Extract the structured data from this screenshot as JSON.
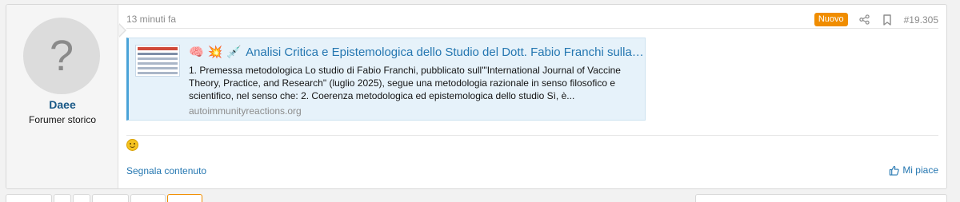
{
  "post": {
    "user": {
      "avatar_glyph": "?",
      "username": "Daee",
      "title": "Forumer storico"
    },
    "header": {
      "time": "13 minuti fa",
      "badge": "Nuovo",
      "post_number": "#19.305",
      "badge_color": "#f08d00"
    },
    "embed": {
      "emojis": [
        "🧠",
        "💥",
        "💉"
      ],
      "title": "Analisi Critica e Epistemologica dello Studio del Dott. Fabio Franchi sulla F...",
      "description": "1. Premessa metodologica Lo studio di Fabio Franchi, pubblicato sull'\"International Journal of Vaccine Theory, Practice, and Research\" (luglio 2025), segue una metodologia razionale in senso filosofico e scientifico, nel senso che: 2. Coerenza metodologica ed epistemologica dello studio Sì, è...",
      "domain": "autoimmunityreactions.org"
    },
    "footer": {
      "report_label": "Segnala contenuto",
      "like_label": "Mi piace"
    }
  },
  "colors": {
    "link": "#2577b1",
    "username": "#185886",
    "embed_bg": "#e6f2fa",
    "embed_accent": "#4aa3d8"
  }
}
